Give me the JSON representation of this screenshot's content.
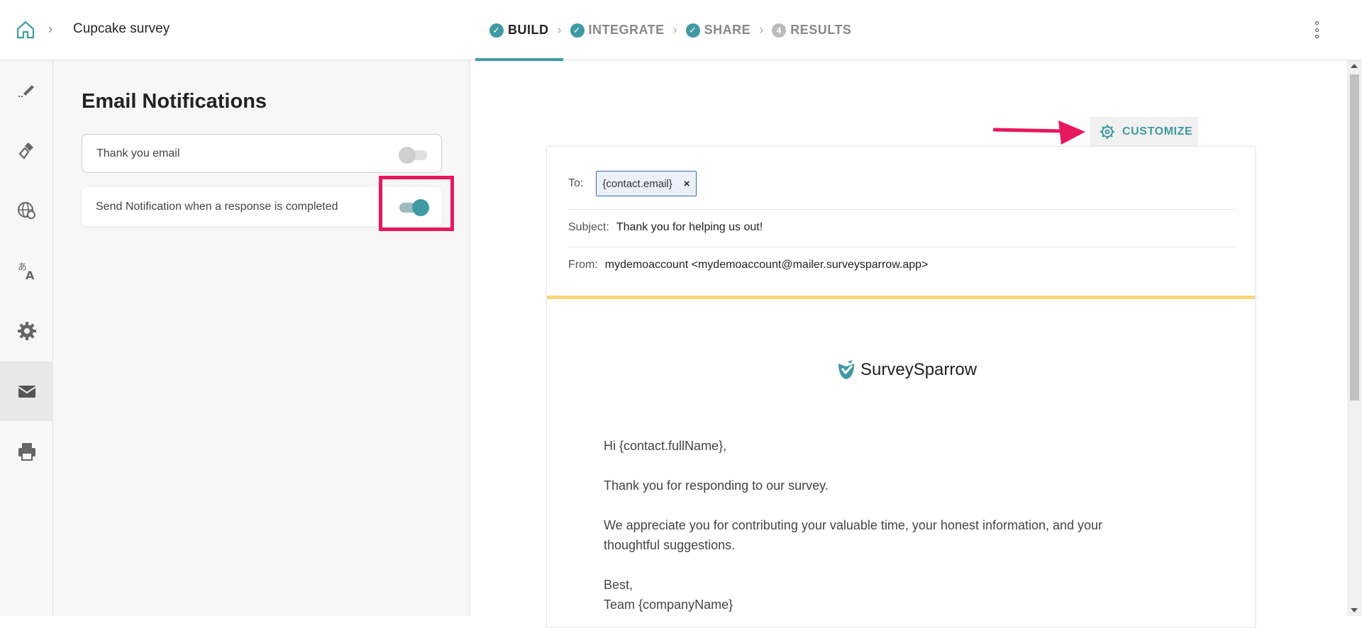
{
  "header": {
    "survey_name": "Cupcake survey",
    "steps": [
      {
        "label": "BUILD",
        "state": "done",
        "icon": "check-icon"
      },
      {
        "label": "INTEGRATE",
        "state": "done",
        "icon": "check-icon"
      },
      {
        "label": "SHARE",
        "state": "done",
        "icon": "check-icon"
      },
      {
        "label": "RESULTS",
        "state": "pending",
        "number": "4"
      }
    ],
    "active_step": "BUILD"
  },
  "rail": {
    "items": [
      {
        "icon": "pen-icon"
      },
      {
        "icon": "paint-brush-icon"
      },
      {
        "icon": "globe-icon"
      },
      {
        "icon": "translate-icon"
      },
      {
        "icon": "gear-icon"
      },
      {
        "icon": "mail-icon",
        "active": true
      },
      {
        "icon": "printer-icon"
      }
    ]
  },
  "panel": {
    "title": "Email Notifications",
    "options": [
      {
        "label": "Thank you email",
        "enabled": false
      },
      {
        "label": "Send Notification when a response is completed",
        "enabled": true
      }
    ]
  },
  "preview": {
    "customize_label": "CUSTOMIZE",
    "to_label": "To:",
    "to_chip": "{contact.email}",
    "subject_label": "Subject:",
    "subject_value": "Thank you for helping us out!",
    "from_label": "From:",
    "from_value": "mydemoaccount <mydemoaccount@mailer.surveysparrow.app>",
    "logo_text": "SurveySparrow",
    "greeting": "Hi {contact.fullName},",
    "line1": "Thank you for responding to our survey.",
    "line2": "We appreciate you for contributing your valuable time, your honest information, and your thoughtful suggestions.",
    "signoff": "Best,",
    "signature": "Team {companyName}"
  },
  "colors": {
    "accent": "#3f9aa3",
    "highlight": "#e8185e",
    "divider_yellow": "#f7d57a"
  }
}
